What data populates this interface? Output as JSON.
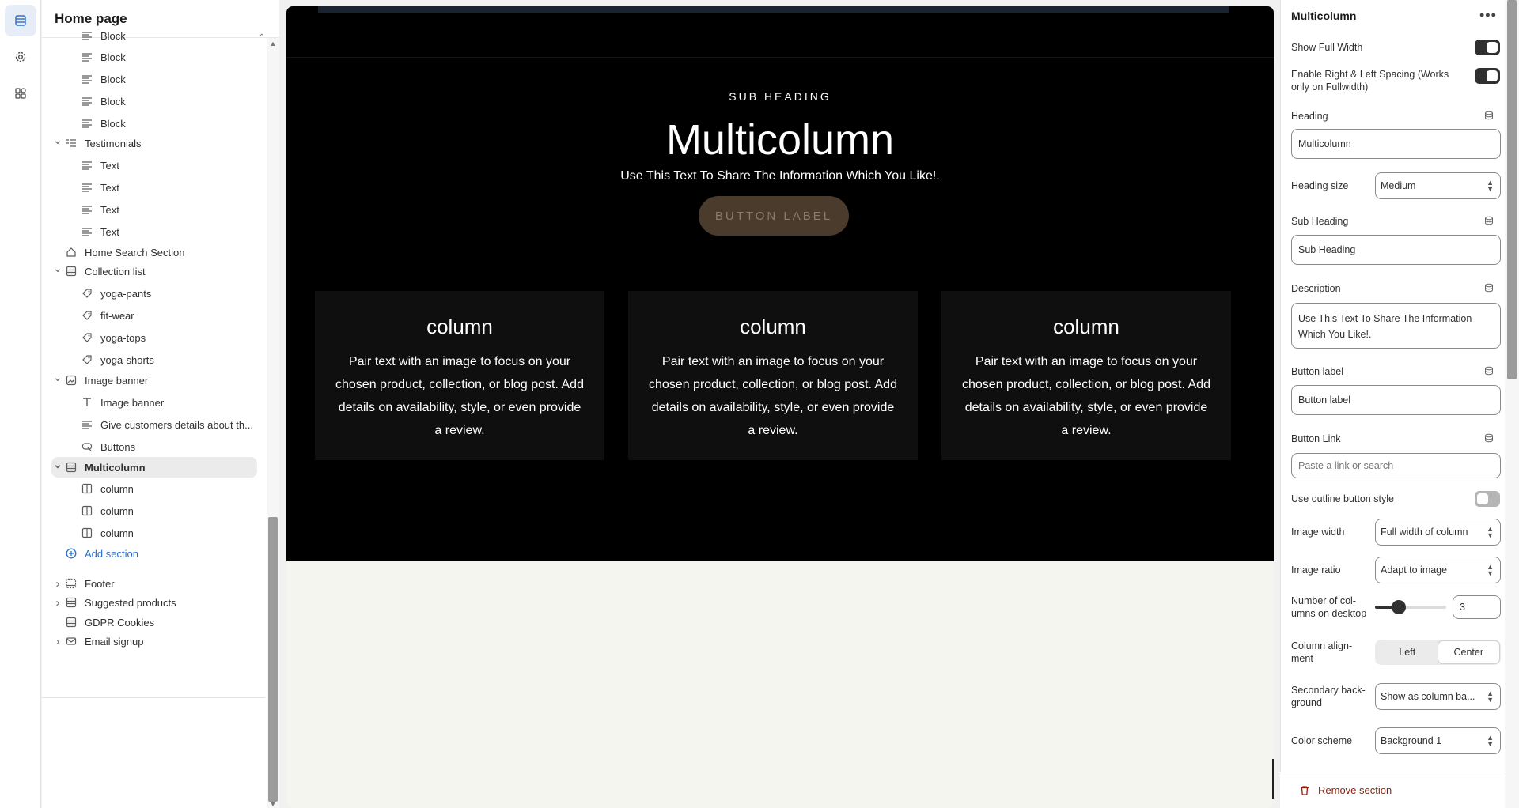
{
  "rail": {
    "items": [
      "sections-icon",
      "gear-icon",
      "apps-icon"
    ]
  },
  "sidebar": {
    "title": "Home page",
    "tree": [
      {
        "label": "Block",
        "icon": "text-block-icon",
        "indent": 2
      },
      {
        "label": "Block",
        "icon": "text-block-icon",
        "indent": 2
      },
      {
        "label": "Block",
        "icon": "text-block-icon",
        "indent": 2
      },
      {
        "label": "Block",
        "icon": "text-block-icon",
        "indent": 2
      },
      {
        "label": "Block",
        "icon": "text-block-icon",
        "indent": 2
      },
      {
        "label": "Testimonials",
        "icon": "testimonials-icon",
        "indent": 1,
        "chevron": "down"
      },
      {
        "label": "Text",
        "icon": "text-block-icon",
        "indent": 2
      },
      {
        "label": "Text",
        "icon": "text-block-icon",
        "indent": 2
      },
      {
        "label": "Text",
        "icon": "text-block-icon",
        "indent": 2
      },
      {
        "label": "Text",
        "icon": "text-block-icon",
        "indent": 2
      },
      {
        "label": "Home Search Section",
        "icon": "home-icon",
        "indent": 1
      },
      {
        "label": "Collection list",
        "icon": "collection-icon",
        "indent": 1,
        "chevron": "down"
      },
      {
        "label": "yoga-pants",
        "icon": "tag-icon",
        "indent": 2
      },
      {
        "label": "fit-wear",
        "icon": "tag-icon",
        "indent": 2
      },
      {
        "label": "yoga-tops",
        "icon": "tag-icon",
        "indent": 2
      },
      {
        "label": "yoga-shorts",
        "icon": "tag-icon",
        "indent": 2
      },
      {
        "label": "Image banner",
        "icon": "image-icon",
        "indent": 1,
        "chevron": "down"
      },
      {
        "label": "Image banner",
        "icon": "heading-icon",
        "indent": 2
      },
      {
        "label": "Give customers details about th...",
        "icon": "text-block-icon",
        "indent": 2
      },
      {
        "label": "Buttons",
        "icon": "button-icon",
        "indent": 2
      },
      {
        "label": "Multicolumn",
        "icon": "collection-icon",
        "indent": 1,
        "chevron": "down",
        "selected": true
      },
      {
        "label": "column",
        "icon": "column-icon",
        "indent": 2
      },
      {
        "label": "column",
        "icon": "column-icon",
        "indent": 2
      },
      {
        "label": "column",
        "icon": "column-icon",
        "indent": 2
      },
      {
        "label": "Add section",
        "icon": "add-circle-icon",
        "indent": 1,
        "add": true
      }
    ],
    "footer_tree": [
      {
        "label": "Footer",
        "icon": "footer-icon",
        "chevron": "right"
      },
      {
        "label": "Suggested products",
        "icon": "collection-icon",
        "chevron": "right"
      },
      {
        "label": "GDPR Cookies",
        "icon": "collection-icon"
      },
      {
        "label": "Email signup",
        "icon": "email-icon",
        "chevron": "right"
      }
    ]
  },
  "preview": {
    "sub_heading": "SUB HEADING",
    "heading": "Multicolumn",
    "description": "Use This Text To Share The Information Which You Like!.",
    "button_label": "BUTTON LABEL",
    "columns": [
      {
        "title": "column",
        "text": "Pair text with an image to focus on your chosen product, collection, or blog post. Add details on availability, style, or even provide a review."
      },
      {
        "title": "column",
        "text": "Pair text with an image to focus on your chosen product, collection, or blog post. Add details on availability, style, or even provide a review."
      },
      {
        "title": "column",
        "text": "Pair text with an image to focus on your chosen product, collection, or blog post. Add details on availability, style, or even provide a review."
      }
    ]
  },
  "panel": {
    "title": "Multicolumn",
    "show_full_width": {
      "label": "Show Full Width",
      "on": true
    },
    "enable_spacing": {
      "label": "Enable Right & Left Spacing (Works only on Fullwidth)",
      "on": true
    },
    "heading": {
      "label": "Heading",
      "value": "Multicolumn"
    },
    "heading_size": {
      "label": "Heading size",
      "value": "Medium"
    },
    "sub_heading": {
      "label": "Sub Heading",
      "value": "Sub Heading"
    },
    "description": {
      "label": "Description",
      "value": "Use This Text To Share The Information Which You Like!."
    },
    "button_label": {
      "label": "Button label",
      "value": "Button label"
    },
    "button_link": {
      "label": "Button Link",
      "placeholder": "Paste a link or search"
    },
    "outline_button": {
      "label": "Use outline button style",
      "on": false
    },
    "image_width": {
      "label": "Image width",
      "value": "Full width of column"
    },
    "image_ratio": {
      "label": "Image ratio",
      "value": "Adapt to image"
    },
    "columns_desktop": {
      "label": "Number of col-umns on desktop",
      "value": "3",
      "fraction": 0.33
    },
    "column_alignment": {
      "label": "Column align-ment",
      "options": [
        "Left",
        "Center"
      ],
      "selected": "Center"
    },
    "secondary_background": {
      "label": "Secondary back-ground",
      "value": "Show as column ba..."
    },
    "color_scheme": {
      "label": "Color scheme",
      "value": "Background 1"
    },
    "remove_section": "Remove section"
  }
}
